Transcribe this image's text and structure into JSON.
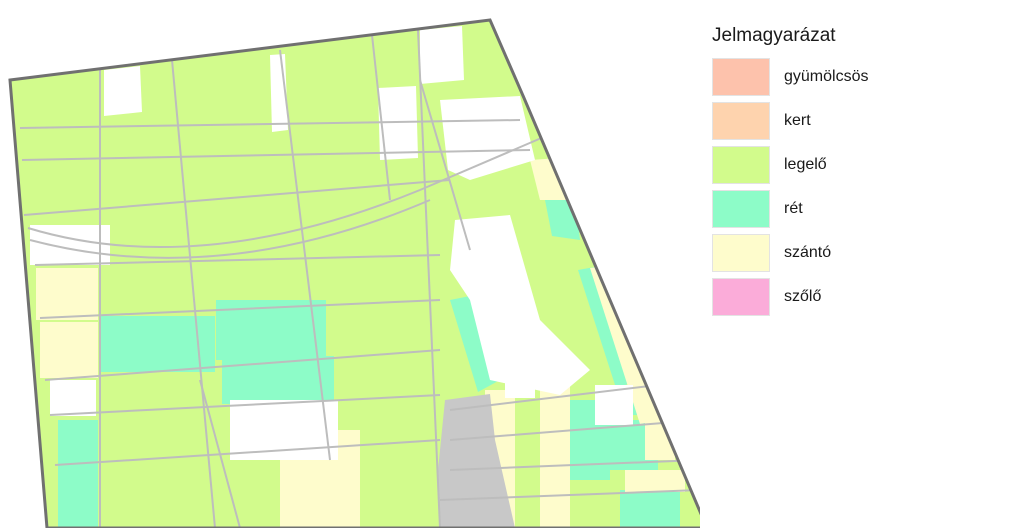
{
  "legend": {
    "title": "Jelmagyarázat",
    "items": [
      {
        "label": "gyümölcsös",
        "color": "#fdc2ac"
      },
      {
        "label": "kert",
        "color": "#fed3ae"
      },
      {
        "label": "legelő",
        "color": "#d2fb8c"
      },
      {
        "label": "rét",
        "color": "#8dfcc8"
      },
      {
        "label": "szántó",
        "color": "#fefccc"
      },
      {
        "label": "szőlő",
        "color": "#fbacd9"
      }
    ]
  },
  "map": {
    "colors": {
      "legelo": "#d2fb8c",
      "ret": "#8dfcc8",
      "szanto": "#fefccc",
      "built": "#c8c8c8",
      "road": "#bdbdbd",
      "border": "#707070",
      "empty": "#ffffff"
    }
  }
}
